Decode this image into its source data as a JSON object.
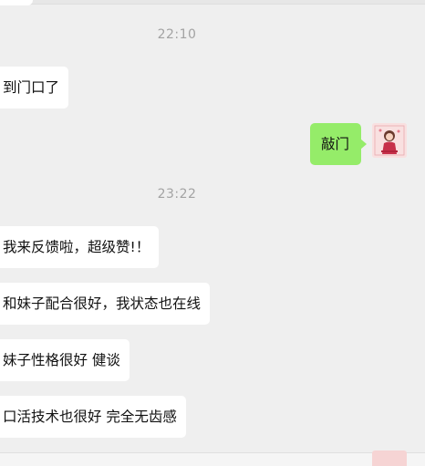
{
  "chat": {
    "timestamps": [
      "22:10",
      "23:22"
    ],
    "messages": [
      {
        "from": "other",
        "text": "到门口了"
      },
      {
        "from": "me",
        "text": "敲门"
      },
      {
        "from": "other",
        "text": "我来反馈啦，超级赞!！"
      },
      {
        "from": "other",
        "text": "和妹子配合很好，我状态也在线"
      },
      {
        "from": "other",
        "text": "妹子性格很好 健谈"
      },
      {
        "from": "other",
        "text": "口活技术也很好 完全无齿感"
      }
    ]
  },
  "colors": {
    "background": "#efefef",
    "incoming_bubble": "#ffffff",
    "outgoing_bubble": "#95ec69",
    "timestamp": "#a3a3a3"
  },
  "icons": {
    "my_avatar": "anime-girl-avatar"
  }
}
